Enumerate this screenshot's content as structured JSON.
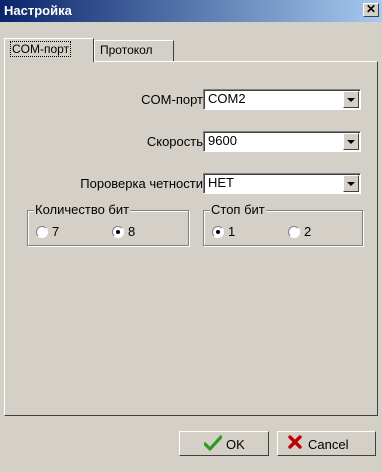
{
  "window": {
    "title": "Настройка",
    "close_symbol": "✕"
  },
  "tabs": [
    {
      "label": "COM-порт",
      "active": true
    },
    {
      "label": "Протокол",
      "active": false
    }
  ],
  "fields": {
    "com_port": {
      "label": "COM-порт",
      "value": "COM2"
    },
    "speed": {
      "label": "Скорость",
      "value": "9600"
    },
    "parity": {
      "label": "Пороверка четности",
      "value": "НЕТ"
    }
  },
  "data_bits": {
    "title": "Количество бит",
    "options": [
      {
        "label": "7",
        "checked": false
      },
      {
        "label": "8",
        "checked": true
      }
    ]
  },
  "stop_bits": {
    "title": "Стоп бит",
    "options": [
      {
        "label": "1",
        "checked": true
      },
      {
        "label": "2",
        "checked": false
      }
    ]
  },
  "buttons": {
    "ok": {
      "label": "OK",
      "icon": "checkmark-icon",
      "icon_color": "#2e9b1e"
    },
    "cancel": {
      "label": "Cancel",
      "icon": "cross-icon",
      "icon_color": "#c00000"
    }
  },
  "colors": {
    "title_start": "#0a246a",
    "title_end": "#a6caf0",
    "face": "#d4d0c8"
  }
}
